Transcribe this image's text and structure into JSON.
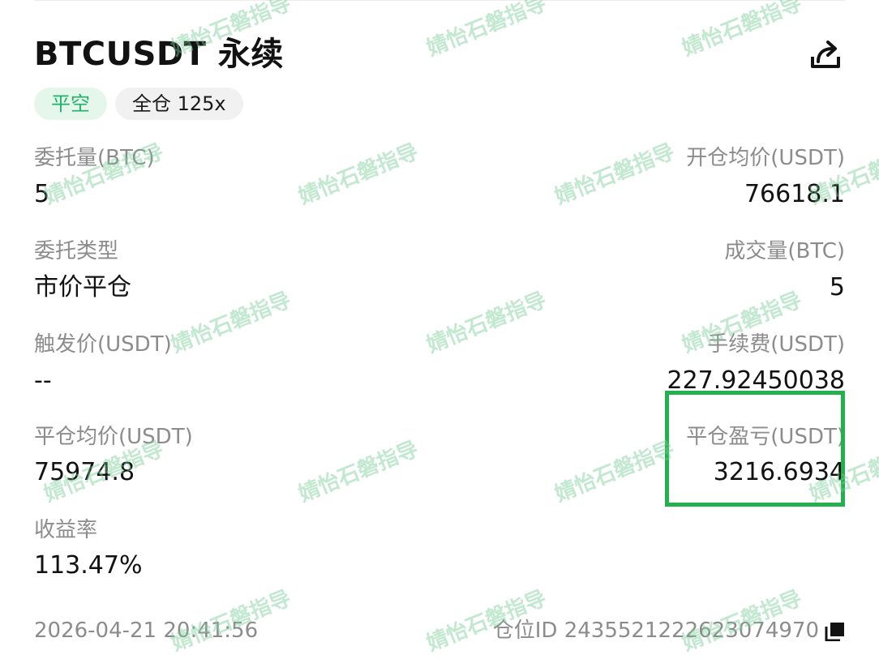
{
  "header": {
    "title": "BTCUSDT 永续"
  },
  "tags": {
    "side": "平空",
    "margin_mode": "全仓 125x"
  },
  "fields": {
    "order_qty": {
      "label": "委托量(BTC)",
      "value": "5"
    },
    "open_avg_price": {
      "label": "开仓均价(USDT)",
      "value": "76618.1"
    },
    "order_type": {
      "label": "委托类型",
      "value": "市价平仓"
    },
    "filled_qty": {
      "label": "成交量(BTC)",
      "value": "5"
    },
    "trigger_price": {
      "label": "触发价(USDT)",
      "value": "--"
    },
    "fee": {
      "label": "手续费(USDT)",
      "value": "227.92450038"
    },
    "close_avg_price": {
      "label": "平仓均价(USDT)",
      "value": "75974.8"
    },
    "close_pnl": {
      "label": "平仓盈亏(USDT)",
      "value": "3216.6934"
    },
    "roi": {
      "label": "收益率",
      "value": "113.47%"
    }
  },
  "footer": {
    "timestamp": "2026-04-21 20:41:56",
    "position_id": "仓位ID 2435521222623074970"
  },
  "icons": {
    "share": "share-icon",
    "copy": "copy-icon"
  },
  "colors": {
    "accent_green": "#20b26c",
    "highlight_border": "#22b14c",
    "label_gray": "#8c8c8c"
  },
  "watermark": "婧怡石磐指导"
}
